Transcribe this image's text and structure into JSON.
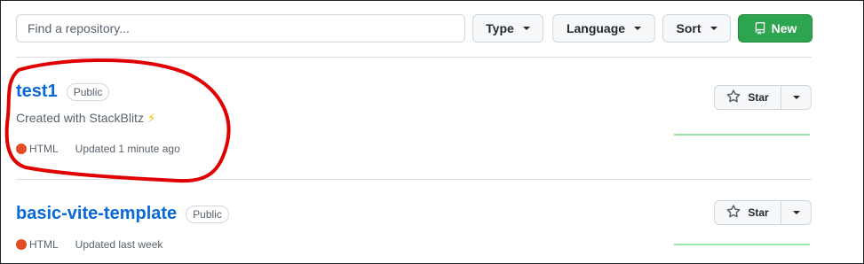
{
  "filter_bar": {
    "search_placeholder": "Find a repository...",
    "type_label": "Type",
    "language_label": "Language",
    "sort_label": "Sort",
    "new_label": "New"
  },
  "repos": [
    {
      "name": "test1",
      "visibility": "Public",
      "description": "Created with StackBlitz",
      "description_emoji": "⚡",
      "language": "HTML",
      "language_color": "#e34c26",
      "updated": "Updated 1 minute ago",
      "star_label": "Star"
    },
    {
      "name": "basic-vite-template",
      "visibility": "Public",
      "language": "HTML",
      "language_color": "#e34c26",
      "updated": "Updated last week",
      "star_label": "Star"
    }
  ],
  "colors": {
    "accent_link": "#0969da",
    "new_button": "#2da44e",
    "annotation": "#e00000"
  }
}
